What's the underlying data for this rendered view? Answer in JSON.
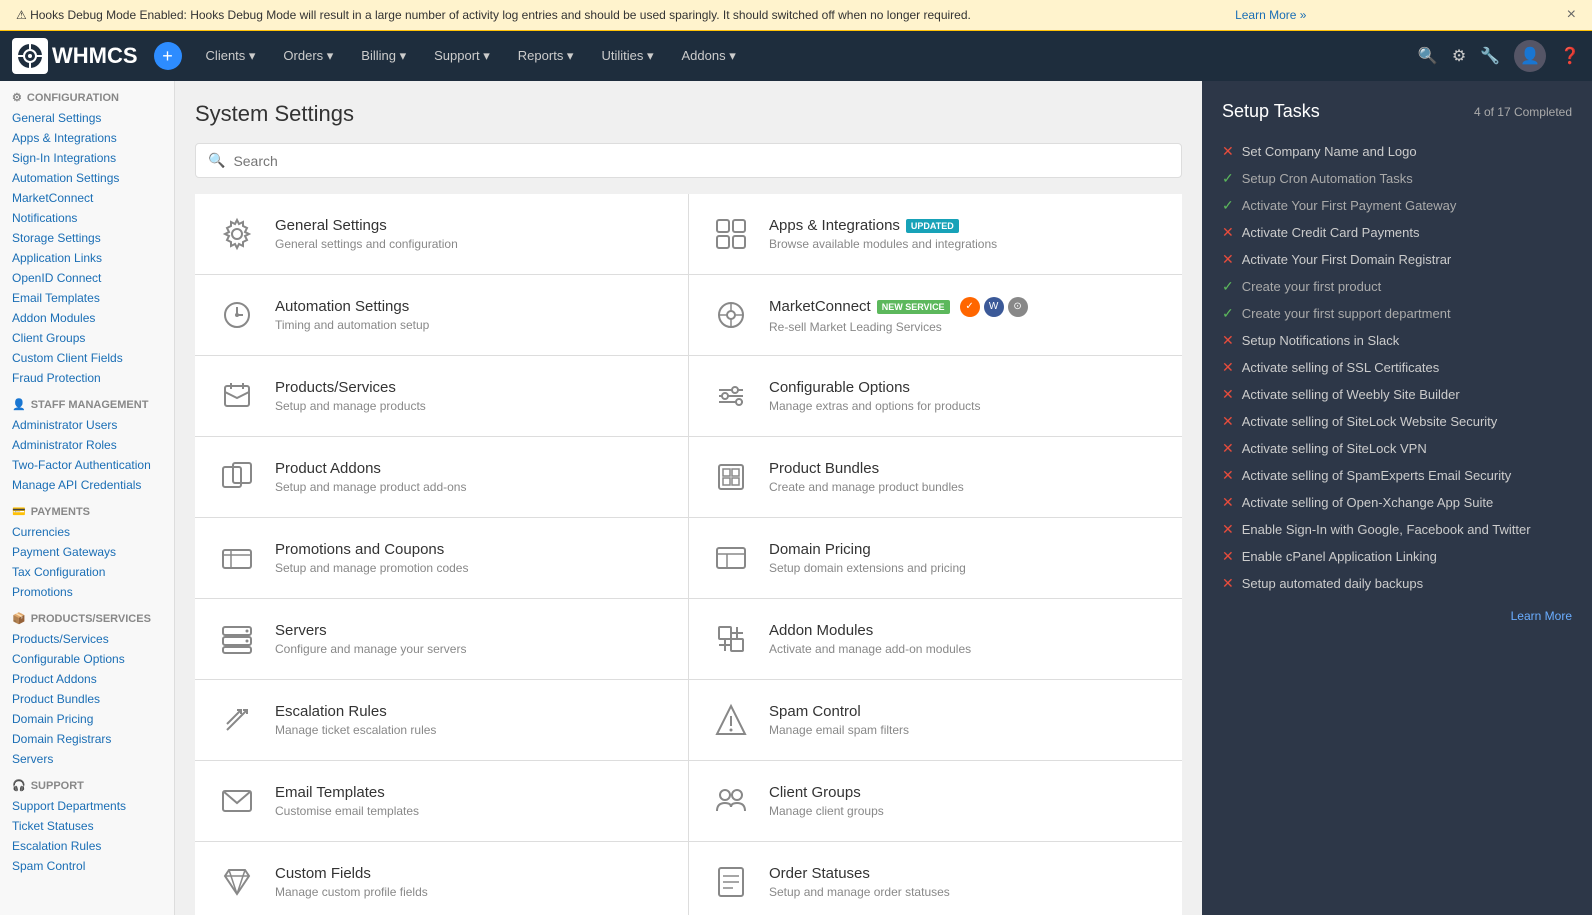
{
  "warning": {
    "text": "⚠ Hooks Debug Mode Enabled: Hooks Debug Mode will result in a large number of activity log entries and should be used sparingly. It should switched off when no longer required.",
    "link_text": "Learn More »",
    "close_label": "×"
  },
  "navbar": {
    "logo": "WHMCS",
    "add_label": "+",
    "items": [
      {
        "label": "Clients",
        "has_arrow": true
      },
      {
        "label": "Orders",
        "has_arrow": true
      },
      {
        "label": "Billing",
        "has_arrow": true
      },
      {
        "label": "Support",
        "has_arrow": true
      },
      {
        "label": "Reports",
        "has_arrow": true
      },
      {
        "label": "Utilities",
        "has_arrow": true
      },
      {
        "label": "Addons",
        "has_arrow": true
      }
    ]
  },
  "sidebar": {
    "sections": [
      {
        "title": "Configuration",
        "icon": "⚙",
        "links": [
          "General Settings",
          "Apps & Integrations",
          "Sign-In Integrations",
          "Automation Settings",
          "MarketConnect",
          "Notifications",
          "Storage Settings",
          "Application Links",
          "OpenID Connect",
          "Email Templates",
          "Addon Modules",
          "Client Groups",
          "Custom Client Fields",
          "Fraud Protection"
        ]
      },
      {
        "title": "Staff Management",
        "icon": "👤",
        "links": [
          "Administrator Users",
          "Administrator Roles",
          "Two-Factor Authentication",
          "Manage API Credentials"
        ]
      },
      {
        "title": "Payments",
        "icon": "💳",
        "links": [
          "Currencies",
          "Payment Gateways",
          "Tax Configuration",
          "Promotions"
        ]
      },
      {
        "title": "Products/Services",
        "icon": "📦",
        "links": [
          "Products/Services",
          "Configurable Options",
          "Product Addons",
          "Product Bundles",
          "Domain Pricing",
          "Domain Registrars",
          "Servers"
        ]
      },
      {
        "title": "Support",
        "icon": "🎧",
        "links": [
          "Support Departments",
          "Ticket Statuses",
          "Escalation Rules",
          "Spam Control"
        ]
      }
    ]
  },
  "page": {
    "title": "System Settings",
    "search_placeholder": "Search"
  },
  "settings_cards": [
    {
      "icon": "⚙",
      "title": "General Settings",
      "desc": "General settings and configuration",
      "badge": null
    },
    {
      "icon": "🔗",
      "title": "Apps & Integrations",
      "desc": "Browse available modules and integrations",
      "badge": "UPDATED"
    },
    {
      "icon": "🕐",
      "title": "Automation Settings",
      "desc": "Timing and automation setup",
      "badge": null
    },
    {
      "icon": "🎯",
      "title": "MarketConnect",
      "desc": "Re-sell Market Leading Services",
      "badge": "NEW SERVICE"
    },
    {
      "icon": "📦",
      "title": "Products/Services",
      "desc": "Setup and manage products",
      "badge": null
    },
    {
      "icon": "⚙",
      "title": "Configurable Options",
      "desc": "Manage extras and options for products",
      "badge": null
    },
    {
      "icon": "🔌",
      "title": "Product Addons",
      "desc": "Setup and manage product add-ons",
      "badge": null
    },
    {
      "icon": "📦",
      "title": "Product Bundles",
      "desc": "Create and manage product bundles",
      "badge": null
    },
    {
      "icon": "🖥",
      "title": "Promotions and Coupons",
      "desc": "Setup and manage promotion codes",
      "badge": null
    },
    {
      "icon": "🌐",
      "title": "Domain Pricing",
      "desc": "Setup domain extensions and pricing",
      "badge": null
    },
    {
      "icon": "🖥",
      "title": "Servers",
      "desc": "Configure and manage your servers",
      "badge": null
    },
    {
      "icon": "🧩",
      "title": "Addon Modules",
      "desc": "Activate and manage add-on modules",
      "badge": null
    },
    {
      "icon": "↗",
      "title": "Escalation Rules",
      "desc": "Manage ticket escalation rules",
      "badge": null
    },
    {
      "icon": "🔻",
      "title": "Spam Control",
      "desc": "Manage email spam filters",
      "badge": null
    },
    {
      "icon": "✉",
      "title": "Email Templates",
      "desc": "Customise email templates",
      "badge": null
    },
    {
      "icon": "👥",
      "title": "Client Groups",
      "desc": "Manage client groups",
      "badge": null
    },
    {
      "icon": "🏷",
      "title": "Custom Fields",
      "desc": "Manage custom profile fields",
      "badge": null
    },
    {
      "icon": "📄",
      "title": "Order Statuses",
      "desc": "Setup and manage order statuses",
      "badge": null
    }
  ],
  "setup_tasks": {
    "title": "Setup Tasks",
    "progress": "4 of 17 Completed",
    "tasks": [
      {
        "label": "Set Company Name and Logo",
        "done": false
      },
      {
        "label": "Setup Cron Automation Tasks",
        "done": true
      },
      {
        "label": "Activate Your First Payment Gateway",
        "done": true
      },
      {
        "label": "Activate Credit Card Payments",
        "done": false
      },
      {
        "label": "Activate Your First Domain Registrar",
        "done": false
      },
      {
        "label": "Create your first product",
        "done": true
      },
      {
        "label": "Create your first support department",
        "done": true
      },
      {
        "label": "Setup Notifications in Slack",
        "done": false
      },
      {
        "label": "Activate selling of SSL Certificates",
        "done": false
      },
      {
        "label": "Activate selling of Weebly Site Builder",
        "done": false
      },
      {
        "label": "Activate selling of SiteLock Website Security",
        "done": false
      },
      {
        "label": "Activate selling of SiteLock VPN",
        "done": false
      },
      {
        "label": "Activate selling of SpamExperts Email Security",
        "done": false
      },
      {
        "label": "Activate selling of Open-Xchange App Suite",
        "done": false
      },
      {
        "label": "Enable Sign-In with Google, Facebook and Twitter",
        "done": false
      },
      {
        "label": "Enable cPanel Application Linking",
        "done": false
      },
      {
        "label": "Setup automated daily backups",
        "done": false
      }
    ],
    "learn_more_label": "Learn More"
  }
}
